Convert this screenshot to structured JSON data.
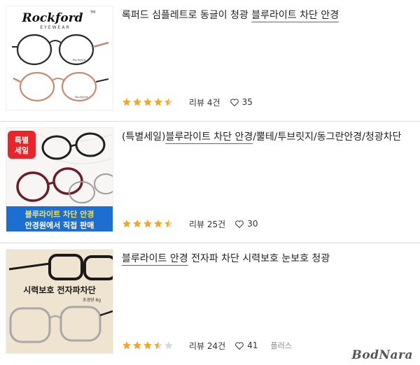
{
  "products": [
    {
      "title_pre": "록퍼드 심플레트로 동글이 청광 ",
      "title_hl": "블루라이트 차단 안경",
      "title_post": "",
      "rating": 4.5,
      "review_text": "리뷰 4건",
      "like_count": "35",
      "extra": "",
      "thumb": {
        "logo": "Rockford",
        "logo_sub": "EYEWEAR",
        "tm": "TM",
        "temple1": "Rockford",
        "temple2": "Rockford"
      }
    },
    {
      "title_pre": "(특별세일)",
      "title_hl": "블루라이트 차단 안경",
      "title_post": "/뿔테/투브릿지/동그란안경/청광차단",
      "rating": 4.5,
      "review_text": "리뷰 25건",
      "like_count": "30",
      "extra": "",
      "thumb": {
        "badge_line1": "특별",
        "badge_line2": "세일",
        "banner_line1": "블루라이트 차단 안경",
        "banner_line2": "안경원에서 직접 판매"
      }
    },
    {
      "title_pre": "",
      "title_hl": "블루라이트 안경",
      "title_post": " 전자파 차단 시력보호 눈보호 청광",
      "rating": 3.5,
      "review_text": "리뷰 24건",
      "like_count": "41",
      "extra": "플러스",
      "thumb": {
        "headline": "시력보호 전자파차단",
        "subline": "초경량 8g"
      }
    }
  ],
  "colors": {
    "star": "#f5a623",
    "star_empty": "#d9d9d9",
    "underline": "#e0322e",
    "badge": "#e8262a",
    "banner": "#1c6fd1"
  },
  "watermark": "BodNara"
}
